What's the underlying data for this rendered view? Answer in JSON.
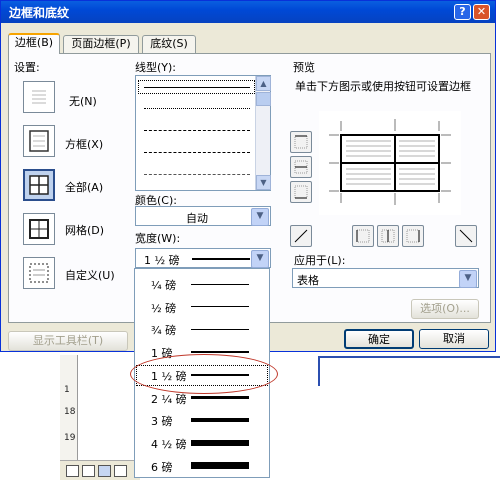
{
  "dialog": {
    "title": "边框和底纹",
    "help": "?",
    "close": "✕"
  },
  "tabs": [
    {
      "label": "边框(B)",
      "selected": true
    },
    {
      "label": "页面边框(P)",
      "selected": false
    },
    {
      "label": "底纹(S)",
      "selected": false
    }
  ],
  "settings": {
    "label": "设置:",
    "items": [
      {
        "label": "无(N)"
      },
      {
        "label": "方框(X)"
      },
      {
        "label": "全部(A)",
        "selected": true
      },
      {
        "label": "网格(D)"
      },
      {
        "label": "自定义(U)"
      }
    ]
  },
  "style": {
    "label": "线型(Y):"
  },
  "color": {
    "label": "颜色(C):",
    "value": "自动"
  },
  "width": {
    "label": "宽度(W):",
    "value": "1 ½ 磅"
  },
  "width_options": [
    {
      "label": "¼ 磅",
      "weight": 1
    },
    {
      "label": "½ 磅",
      "weight": 1
    },
    {
      "label": "¾ 磅",
      "weight": 1
    },
    {
      "label": "1 磅",
      "weight": 1.5
    },
    {
      "label": "1 ½ 磅",
      "weight": 2,
      "selected": true
    },
    {
      "label": "2 ¼ 磅",
      "weight": 3
    },
    {
      "label": "3 磅",
      "weight": 4
    },
    {
      "label": "4 ½ 磅",
      "weight": 6
    },
    {
      "label": "6 磅",
      "weight": 7
    }
  ],
  "preview": {
    "label": "预览",
    "hint": "单击下方图示或使用按钮可设置边框"
  },
  "apply_to": {
    "label": "应用于(L):",
    "value": "表格"
  },
  "buttons": {
    "options": "选项(O)...",
    "show_toolbar": "显示工具栏(T)",
    "ok": "确定",
    "cancel": "取消"
  },
  "background_document": {
    "ruler_numbers": [
      "1",
      "18",
      "19"
    ],
    "accent_color": "#2b4fb0"
  },
  "colors": {
    "title_bar": "#0049d6",
    "dialog_bg": "#ece9d8",
    "annotation_circle": "#c0392b"
  }
}
